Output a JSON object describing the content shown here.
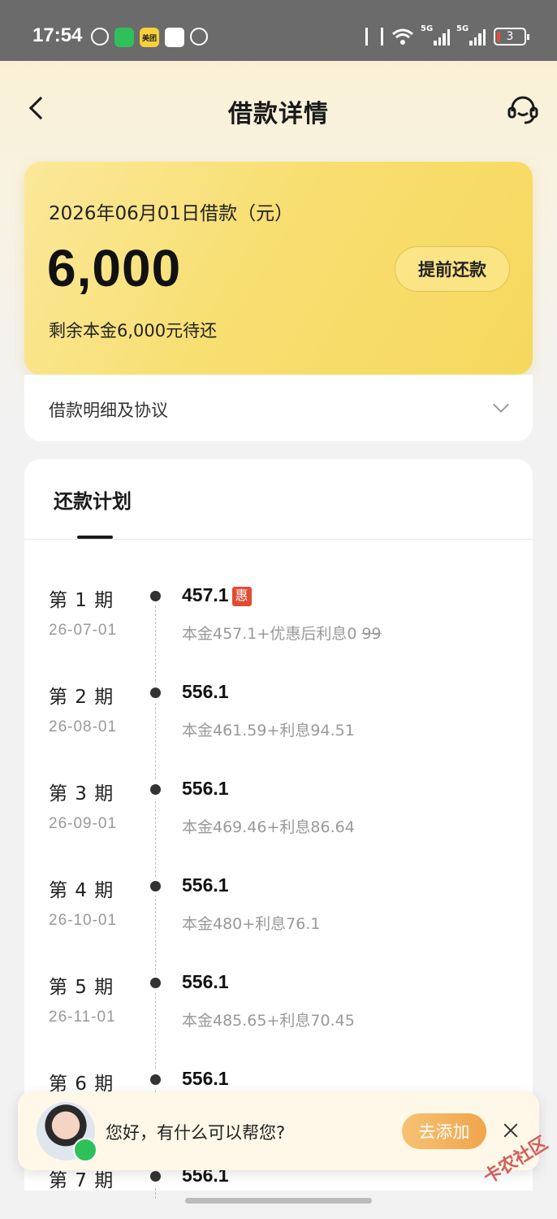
{
  "status_bar": {
    "time": "17:54",
    "meituan_label": "美团",
    "network_label_1": "5G",
    "network_label_2": "5G",
    "battery_level": "3"
  },
  "nav": {
    "title": "借款详情"
  },
  "loan_card": {
    "date_label": "2026年06月01日借款（元）",
    "amount": "6,000",
    "prepay_label": "提前还款",
    "remaining_text": "剩余本金6,000元待还"
  },
  "detail_row": {
    "label": "借款明细及协议"
  },
  "plan": {
    "tab_label": "还款计划",
    "periods": [
      {
        "label": "第 1 期",
        "date": "26-07-01",
        "amount": "457.1",
        "badge": "惠",
        "detail": "本金457.1+优惠后利息0",
        "strike": "99"
      },
      {
        "label": "第 2 期",
        "date": "26-08-01",
        "amount": "556.1",
        "detail": "本金461.59+利息94.51"
      },
      {
        "label": "第 3 期",
        "date": "26-09-01",
        "amount": "556.1",
        "detail": "本金469.46+利息86.64"
      },
      {
        "label": "第 4 期",
        "date": "26-10-01",
        "amount": "556.1",
        "detail": "本金480+利息76.1"
      },
      {
        "label": "第 5 期",
        "date": "26-11-01",
        "amount": "556.1",
        "detail": "本金485.65+利息70.45"
      },
      {
        "label": "第 6 期",
        "date": "",
        "amount": "556.1",
        "detail": ""
      },
      {
        "label": "第 7 期",
        "date": "",
        "amount": "556.1",
        "detail": ""
      }
    ]
  },
  "chat_bar": {
    "greeting": "您好，有什么可以帮您?",
    "add_label": "去添加"
  },
  "watermark": "卡农社区",
  "colors": {
    "card_yellow": "#f8df72",
    "badge_red": "#e24b33",
    "add_button_orange": "#f1a44a",
    "wechat_green": "#2fc05a"
  }
}
